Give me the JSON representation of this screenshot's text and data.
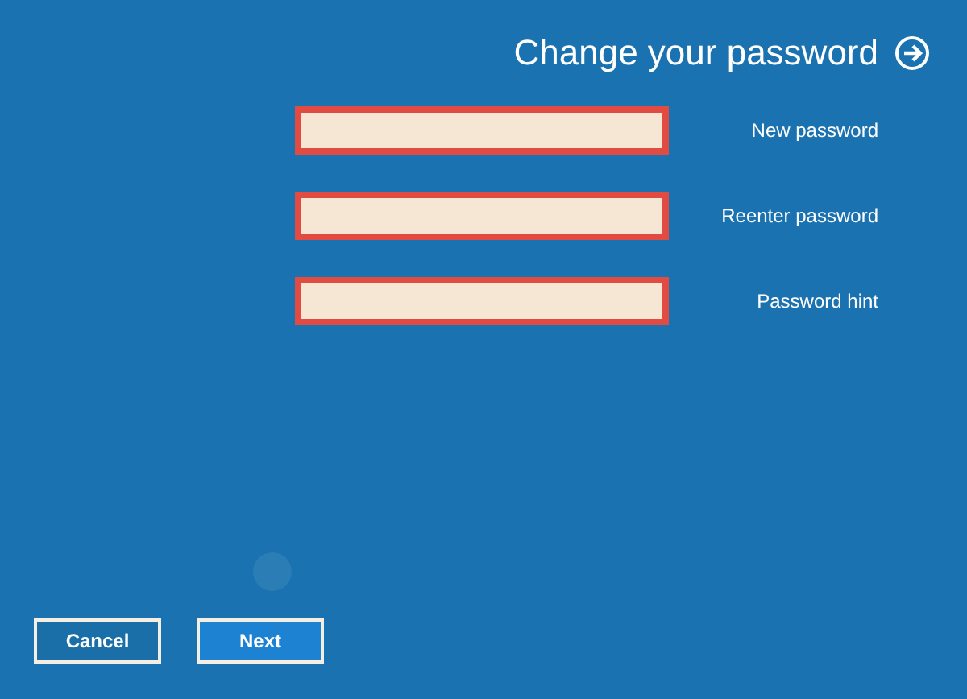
{
  "title": "Change your password",
  "fields": [
    {
      "label": "New password",
      "invalid": true
    },
    {
      "label": "Reenter password",
      "invalid": true
    },
    {
      "label": "Password hint",
      "invalid": true
    }
  ],
  "buttons": [
    {
      "label": "Cancel",
      "kind": "secondary"
    },
    {
      "label": "Next",
      "kind": "primary"
    }
  ]
}
